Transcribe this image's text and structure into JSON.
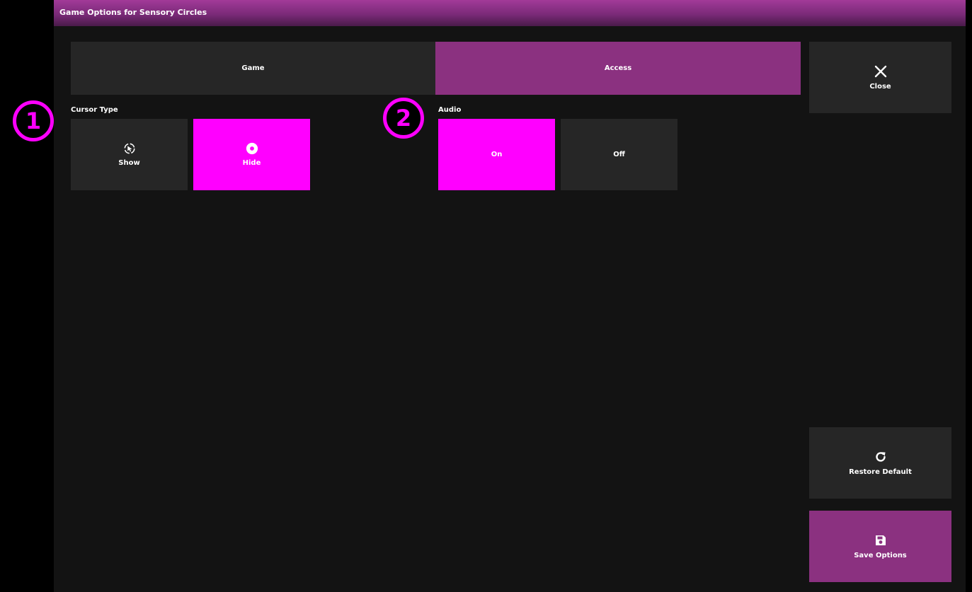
{
  "window": {
    "title": "Game Options for Sensory Circles"
  },
  "tabs": [
    {
      "label": "Game",
      "active": false
    },
    {
      "label": "Access",
      "active": true
    }
  ],
  "cursor_type": {
    "label": "Cursor Type",
    "options": [
      {
        "label": "Show",
        "icon": "cursor-show-icon",
        "selected": false
      },
      {
        "label": "Hide",
        "icon": "cursor-hide-icon",
        "selected": true
      }
    ]
  },
  "audio": {
    "label": "Audio",
    "options": [
      {
        "label": "On",
        "selected": true
      },
      {
        "label": "Off",
        "selected": false
      }
    ]
  },
  "sidebar": {
    "close_label": "Close",
    "restore_label": "Restore Default",
    "save_label": "Save Options"
  },
  "callouts": [
    "1",
    "2"
  ],
  "colors": {
    "accent_magenta": "#ff00ff",
    "accent_purple": "#8b3180",
    "panel_dark": "#262626",
    "background": "#131313"
  }
}
